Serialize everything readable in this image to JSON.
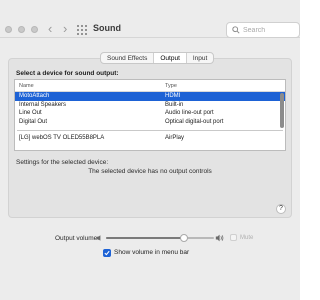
{
  "window": {
    "title": "Sound"
  },
  "search": {
    "placeholder": "Search"
  },
  "tabs": [
    {
      "label": "Sound Effects",
      "active": false
    },
    {
      "label": "Output",
      "active": true
    },
    {
      "label": "Input",
      "active": false
    }
  ],
  "output": {
    "select_label": "Select a device for sound output:",
    "columns": {
      "name": "Name",
      "type": "Type"
    },
    "devices": [
      {
        "name": "MotoAttach",
        "type": "HDMI",
        "selected": true
      },
      {
        "name": "Internal Speakers",
        "type": "Built-in",
        "selected": false
      },
      {
        "name": "Line Out",
        "type": "Audio line-out port",
        "selected": false
      },
      {
        "name": "Digital Out",
        "type": "Optical digital-out port",
        "selected": false
      }
    ],
    "airplay_device": {
      "name": "[LG] webOS TV OLED55B8PLA",
      "type": "AirPlay"
    },
    "settings_label": "Settings for the selected device:",
    "no_controls": "The selected device has no output controls",
    "help": "?"
  },
  "volume": {
    "label": "Output volume:",
    "level": 0.72,
    "mute_label": "Mute",
    "mute_checked": false,
    "menu_bar_label": "Show volume in menu bar",
    "menu_bar_checked": true
  },
  "colors": {
    "accent": "#1d62d5",
    "window_bg": "#ececec",
    "panel_bg": "#e3e3e3"
  },
  "icons": [
    "back-arrow-icon",
    "forward-arrow-icon",
    "grid-icon",
    "search-icon",
    "speaker-low-icon",
    "speaker-high-icon",
    "checkmark-icon",
    "help-icon"
  ]
}
